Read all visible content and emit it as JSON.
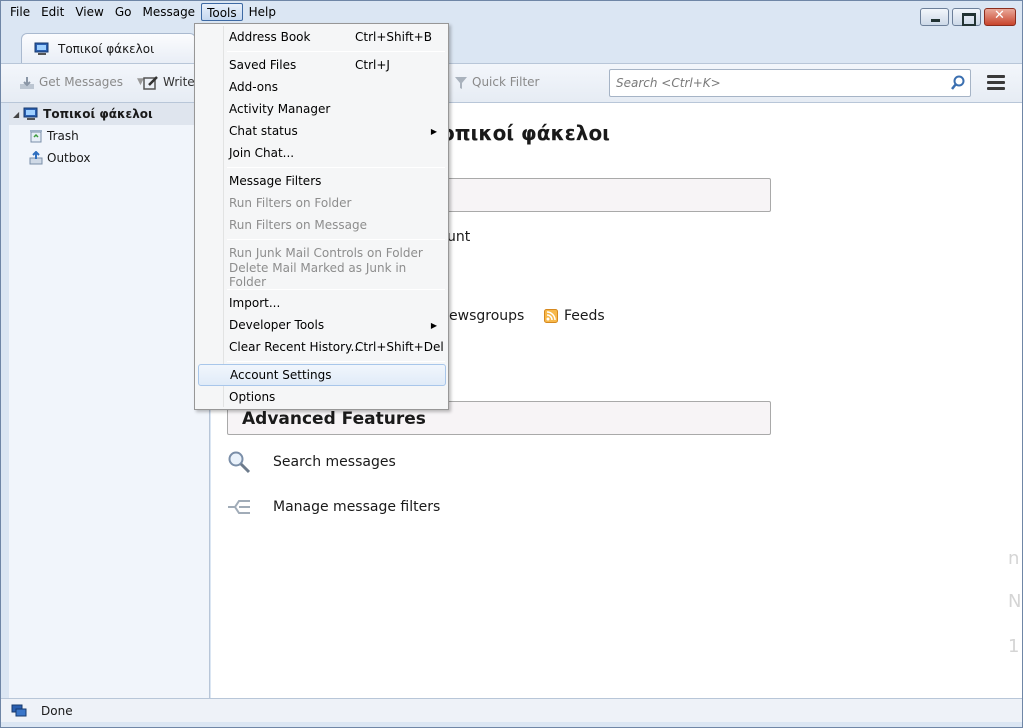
{
  "menubar": {
    "items": [
      "File",
      "Edit",
      "View",
      "Go",
      "Message",
      "Tools",
      "Help"
    ]
  },
  "tab": {
    "title": "Τοπικοί φάκελοι"
  },
  "toolbar": {
    "get_messages": "Get Messages",
    "write": "Write",
    "quick_filter": "Quick Filter",
    "search_placeholder": "Search <Ctrl+K>"
  },
  "sidebar": {
    "root": "Τοπικοί φάκελοι",
    "children": [
      "Trash",
      "Outbox"
    ]
  },
  "main": {
    "heading": "οπικοί φάκελοι",
    "partial_text_1": "unt",
    "newsgroups_partial": "ewsgroups",
    "feeds": "Feeds",
    "advanced_features": "Advanced Features",
    "search_messages": "Search messages",
    "manage_filters": "Manage message filters",
    "faint_chars": [
      "n",
      "N",
      "1"
    ]
  },
  "tools_menu": {
    "items": [
      {
        "label": "Address Book",
        "shortcut": "Ctrl+Shift+B"
      },
      {
        "label": "Saved Files",
        "shortcut": "Ctrl+J"
      },
      {
        "label": "Add-ons",
        "shortcut": ""
      },
      {
        "label": "Activity Manager",
        "shortcut": ""
      },
      {
        "label": "Chat status",
        "shortcut": ""
      },
      {
        "label": "Join Chat...",
        "shortcut": ""
      },
      {
        "label": "Message Filters",
        "shortcut": ""
      },
      {
        "label": "Run Filters on Folder",
        "shortcut": ""
      },
      {
        "label": "Run Filters on Message",
        "shortcut": ""
      },
      {
        "label": "Run Junk Mail Controls on Folder",
        "shortcut": ""
      },
      {
        "label": "Delete Mail Marked as Junk in Folder",
        "shortcut": ""
      },
      {
        "label": "Import...",
        "shortcut": ""
      },
      {
        "label": "Developer Tools",
        "shortcut": ""
      },
      {
        "label": "Clear Recent History...",
        "shortcut": "Ctrl+Shift+Del"
      },
      {
        "label": "Account Settings",
        "shortcut": ""
      },
      {
        "label": "Options",
        "shortcut": ""
      }
    ]
  },
  "status": {
    "text": "Done"
  }
}
